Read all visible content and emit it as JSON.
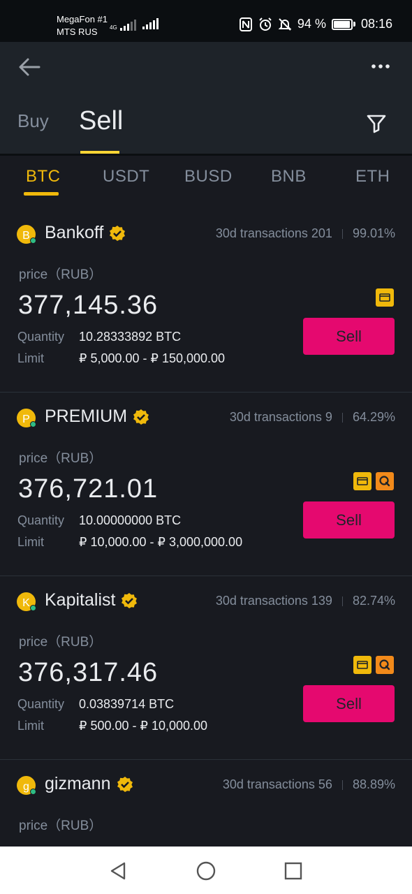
{
  "status_bar": {
    "carrier1": "MegaFon #1",
    "carrier2": "MTS RUS",
    "network": "4G",
    "battery": "94 %",
    "time": "08:16",
    "icons": [
      "nfc-icon",
      "alarm-icon",
      "mute-icon",
      "battery-icon"
    ]
  },
  "header": {
    "tab_buy": "Buy",
    "tab_sell": "Sell",
    "icons": [
      "back-arrow-icon",
      "more-icon",
      "filter-icon"
    ]
  },
  "coin_tabs": [
    "BTC",
    "USDT",
    "BUSD",
    "BNB",
    "ETH"
  ],
  "active_coin": "BTC",
  "colors": {
    "accent": "#f0b90b",
    "sell_button": "#e5096f",
    "background": "#181a20"
  },
  "labels": {
    "price": "price（RUB）",
    "quantity": "Quantity",
    "limit": "Limit",
    "sell_button": "Sell"
  },
  "ads": [
    {
      "initial": "B",
      "name": "Bankoff",
      "transactions": "30d transactions 201",
      "completion": "99.01%",
      "price": "377,145.36",
      "quantity": "10.28333892 BTC",
      "limit": "₽ 5,000.00 - ₽ 150,000.00",
      "payments": [
        "bank-card-icon"
      ]
    },
    {
      "initial": "P",
      "name": "PREMIUM",
      "transactions": "30d transactions 9",
      "completion": "64.29%",
      "price": "376,721.01",
      "quantity": "10.00000000 BTC",
      "limit": "₽ 10,000.00 - ₽ 3,000,000.00",
      "payments": [
        "bank-card-icon",
        "qiwi-icon"
      ]
    },
    {
      "initial": "K",
      "name": "Kapitalist",
      "transactions": "30d transactions 139",
      "completion": "82.74%",
      "price": "376,317.46",
      "quantity": "0.03839714 BTC",
      "limit": "₽ 500.00 - ₽ 10,000.00",
      "payments": [
        "bank-card-icon",
        "qiwi-icon"
      ]
    },
    {
      "initial": "g",
      "name": "gizmann",
      "transactions": "30d transactions 56",
      "completion": "88.89%"
    }
  ],
  "nav_bar": {
    "icons": [
      "nav-back-icon",
      "nav-home-icon",
      "nav-recents-icon"
    ]
  }
}
